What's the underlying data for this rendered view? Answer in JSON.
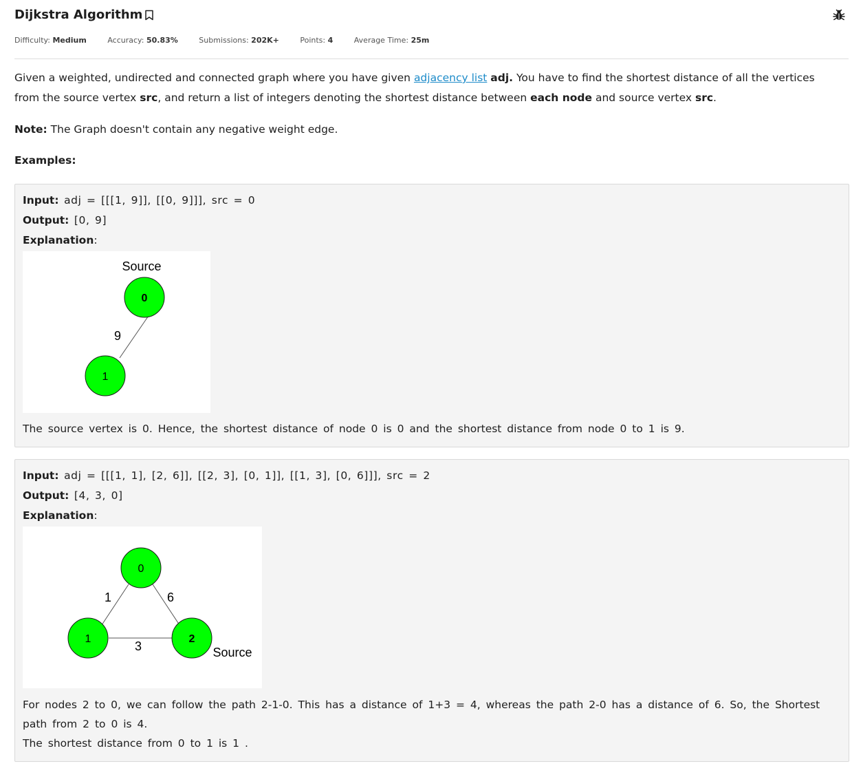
{
  "header": {
    "title": "Dijkstra Algorithm",
    "bookmark_icon": "bookmark-icon",
    "bug_icon": "bug-report-icon"
  },
  "meta": {
    "difficulty_label": "Difficulty:",
    "difficulty_value": "Medium",
    "accuracy_label": "Accuracy:",
    "accuracy_value": "50.83%",
    "submissions_label": "Submissions:",
    "submissions_value": "202K+",
    "points_label": "Points:",
    "points_value": "4",
    "time_label": "Average Time:",
    "time_value": "25m"
  },
  "description": {
    "p1_a": "Given a weighted, undirected and connected graph where you have given ",
    "p1_link": "adjacency list",
    "p1_b": " ",
    "p1_adj": "adj.",
    "p1_c": " You have to find the shortest distance of all the vertices from the source vertex ",
    "p1_src": "src",
    "p1_d": ", and return a list of integers denoting the shortest distance between ",
    "p1_each": "each node",
    "p1_e": " and source vertex ",
    "p1_src2": "src",
    "p1_f": ".",
    "note_label": "Note:",
    "note_text": " The Graph doesn't contain any negative weight edge.",
    "examples_label": "Examples:"
  },
  "examples": [
    {
      "input_label": "Input:",
      "input_value": " adj = [[[1, 9]], [[0, 9]]], src = 0",
      "output_label": "Output:",
      "output_value": " [0, 9]",
      "explanation_label": "Explanation",
      "explanation_colon": ":",
      "graph": {
        "source_label": "Source",
        "node_0": "0",
        "node_1": "1",
        "edge_weight": "9",
        "node_color": "#00ff00"
      },
      "explanation_text": "The source vertex is 0. Hence, the shortest distance of node 0 is 0 and the shortest distance from node 0 to 1 is 9."
    },
    {
      "input_label": "Input:",
      "input_value": " adj = [[[1, 1], [2, 6]], [[2, 3], [0, 1]], [[1, 3], [0, 6]]], src = 2",
      "output_label": "Output:",
      "output_value": " [4, 3, 0]",
      "explanation_label": "Explanation",
      "explanation_colon": ":",
      "graph": {
        "source_label": "Source",
        "node_0": "0",
        "node_1": "1",
        "node_2": "2",
        "edge_01": "1",
        "edge_02": "6",
        "edge_12": "3",
        "node_color": "#00ff00"
      },
      "explanation_line1": "For nodes 2 to 0, we can follow the path 2-1-0. This has a distance of 1+3 = 4, whereas the path 2-0 has a distance of 6. So, the Shortest path from 2 to 0 is 4.",
      "explanation_line2": "The shortest distance from 0 to 1 is 1 ."
    }
  ]
}
